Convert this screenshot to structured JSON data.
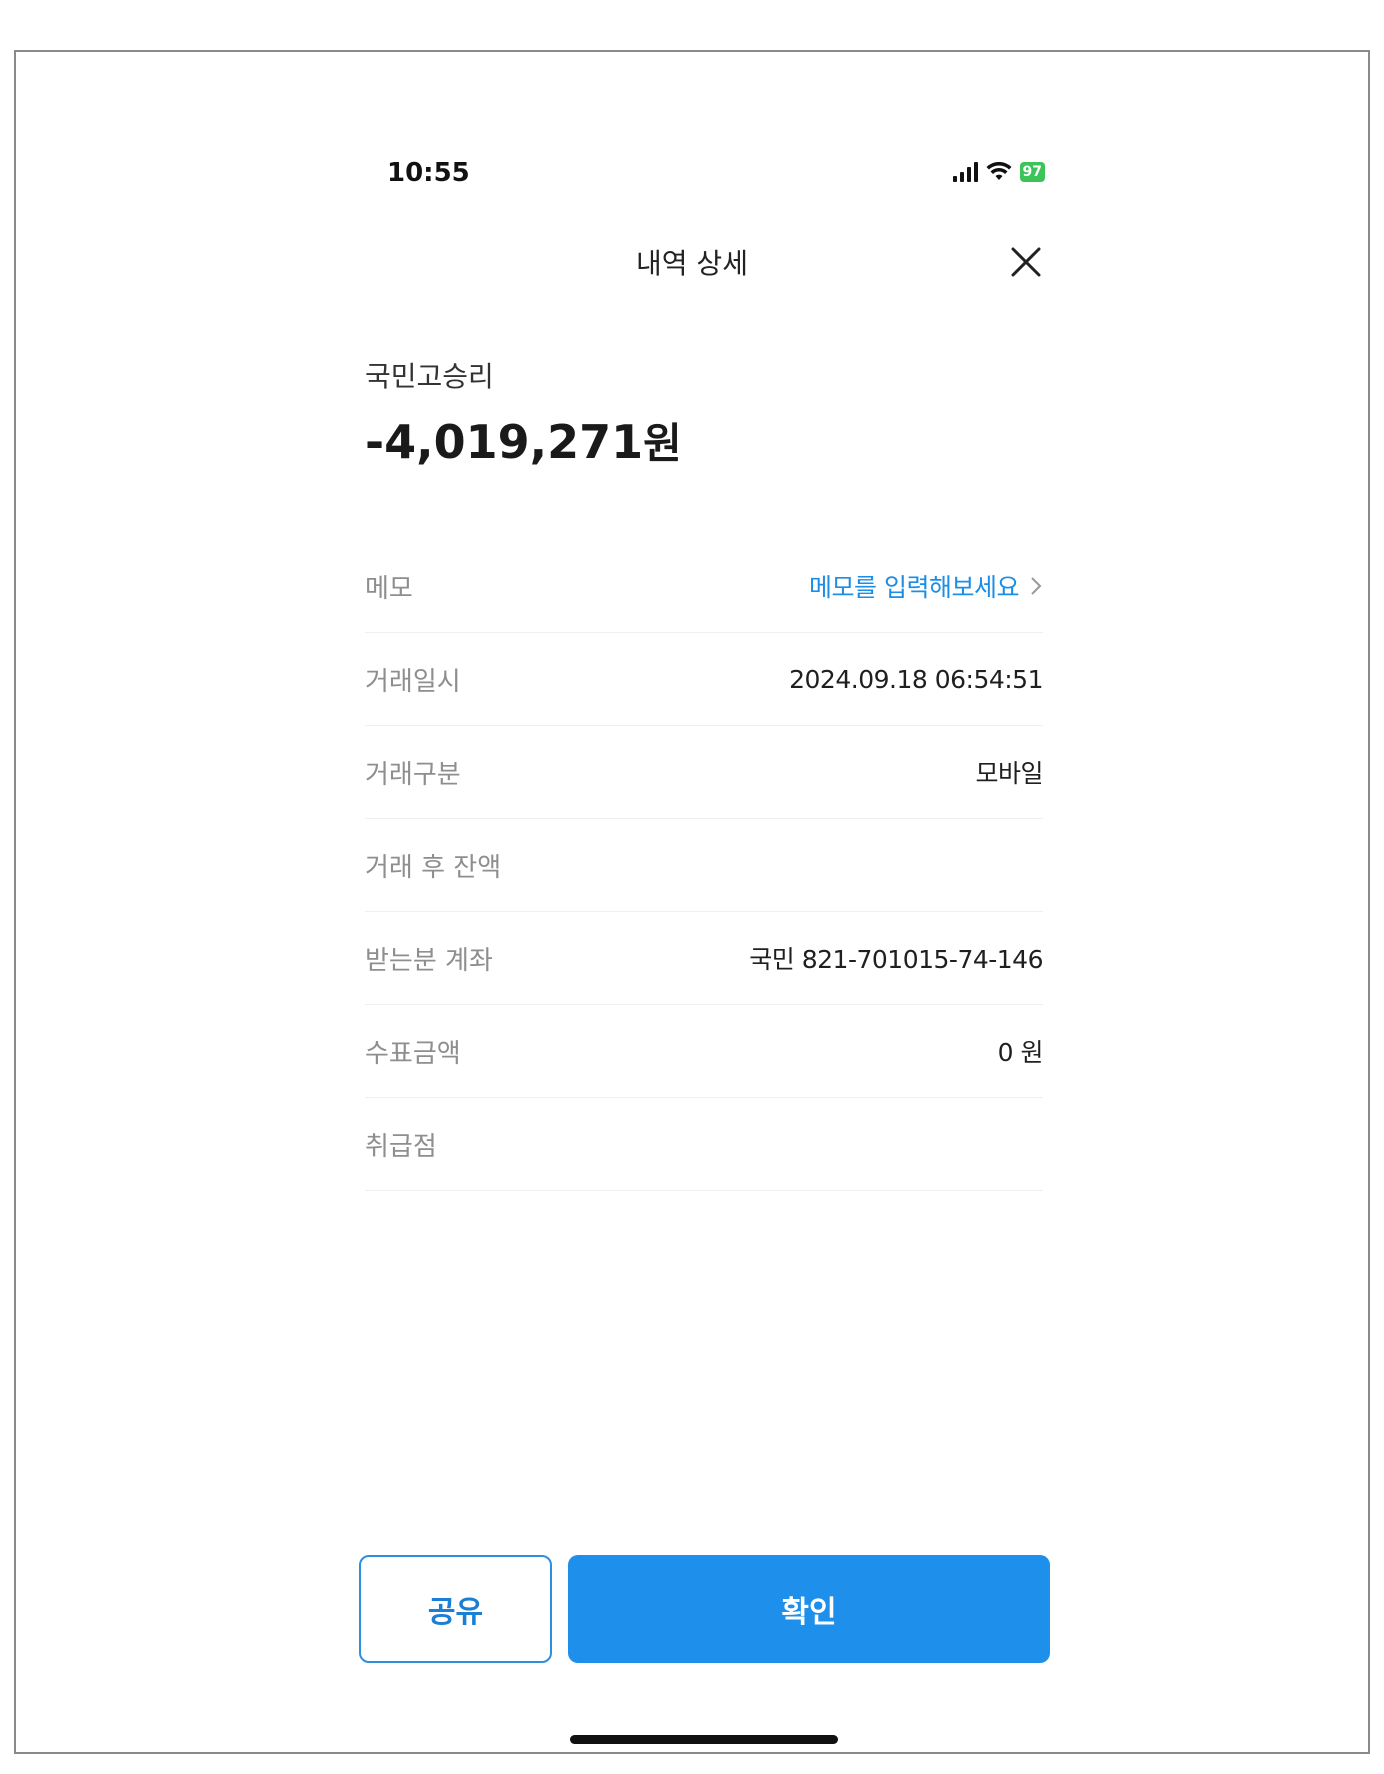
{
  "status_bar": {
    "time": "10:55",
    "battery": "97"
  },
  "header": {
    "title": "내역 상세"
  },
  "summary": {
    "merchant": "국민고승리",
    "amount": "-4,019,271",
    "amount_unit": "원"
  },
  "details": [
    {
      "label": "메모",
      "value": "메모를 입력해보세요"
    },
    {
      "label": "거래일시",
      "value": "2024.09.18 06:54:51"
    },
    {
      "label": "거래구분",
      "value": "모바일"
    },
    {
      "label": "거래 후 잔액",
      "value": ""
    },
    {
      "label": "받는분 계좌",
      "value": "국민 821-701015-74-146"
    },
    {
      "label": "수표금액",
      "value": "0 원"
    },
    {
      "label": "취급점",
      "value": ""
    }
  ],
  "buttons": {
    "share": "공유",
    "confirm": "확인"
  },
  "colors": {
    "accent": "#1e8fea",
    "link": "#1c8ee6",
    "battery": "#3cc35a"
  }
}
